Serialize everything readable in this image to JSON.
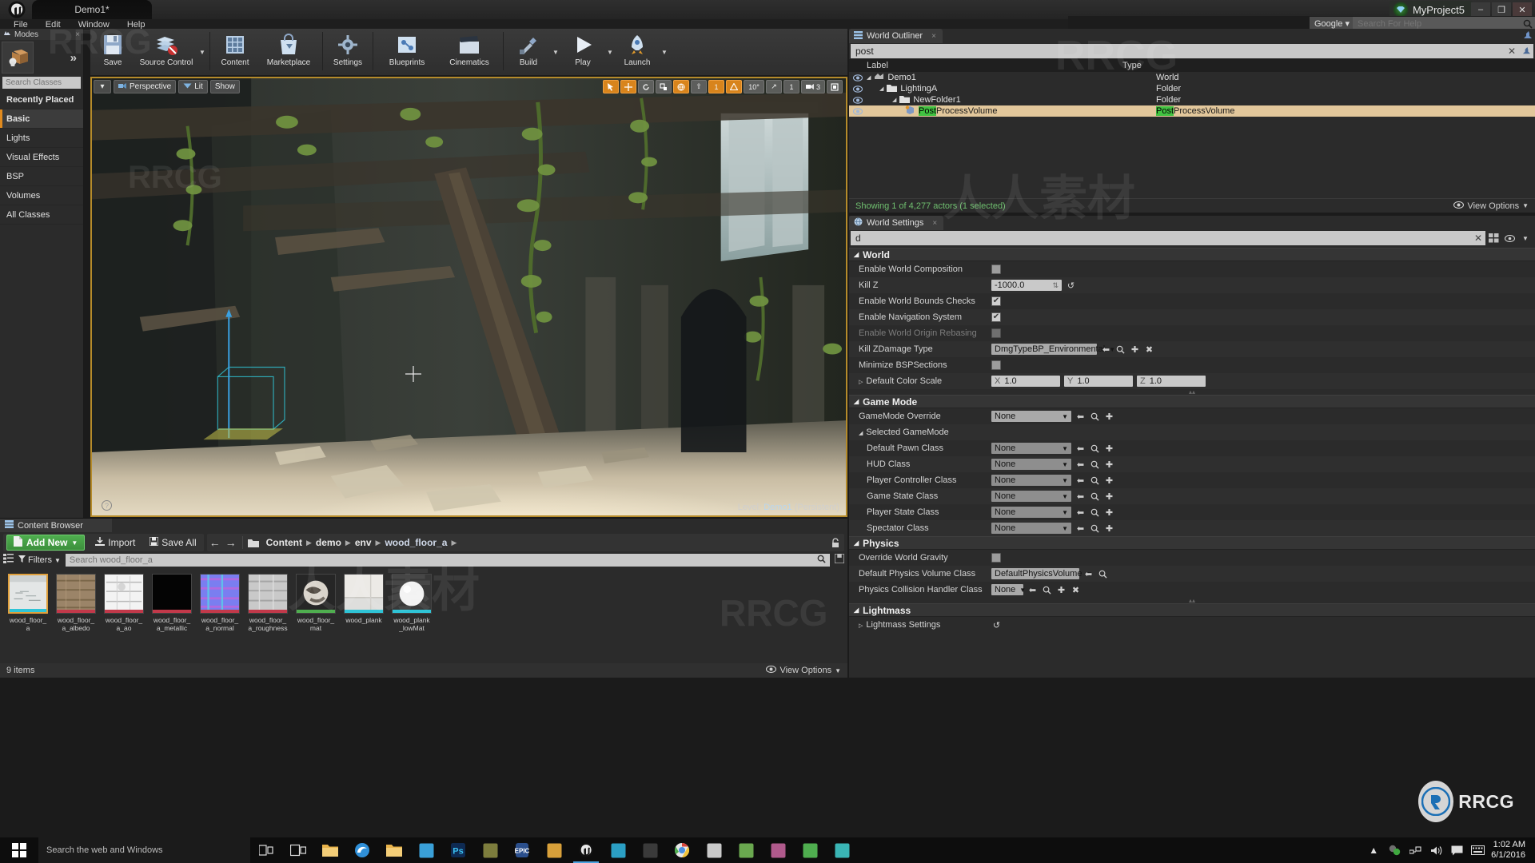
{
  "titlebar": {
    "tab_label": "Demo1*",
    "project_name": "MyProject5",
    "minimize": "–",
    "maximize": "❐",
    "close": "✕",
    "logo_icon": "unreal-engine-logo"
  },
  "menubar": {
    "items": [
      "File",
      "Edit",
      "Window",
      "Help"
    ],
    "search_engine": "Google",
    "help_placeholder": "Search For Help",
    "help_value": ""
  },
  "modes": {
    "title": "Modes",
    "close": "×",
    "expand": "»",
    "search_placeholder": "Search Classes",
    "search_value": "",
    "items": [
      {
        "label": "Recently Placed",
        "selected": false,
        "bold": true
      },
      {
        "label": "Basic",
        "selected": true,
        "bold": true
      },
      {
        "label": "Lights",
        "selected": false,
        "bold": false
      },
      {
        "label": "Visual Effects",
        "selected": false,
        "bold": false
      },
      {
        "label": "BSP",
        "selected": false,
        "bold": false
      },
      {
        "label": "Volumes",
        "selected": false,
        "bold": false
      },
      {
        "label": "All Classes",
        "selected": false,
        "bold": false
      }
    ]
  },
  "toolbar": {
    "buttons": [
      {
        "label": "Save",
        "icon": "save-icon",
        "caret": false
      },
      {
        "label": "Source Control",
        "icon": "source-control-icon",
        "caret": true
      },
      {
        "label": "Content",
        "icon": "content-icon",
        "caret": false
      },
      {
        "label": "Marketplace",
        "icon": "marketplace-icon",
        "caret": false
      },
      {
        "label": "Settings",
        "icon": "settings-gear-icon",
        "caret": false
      },
      {
        "label": "Blueprints",
        "icon": "blueprints-icon",
        "caret": false
      },
      {
        "label": "Cinematics",
        "icon": "cinematics-clapper-icon",
        "caret": false
      },
      {
        "label": "Build",
        "icon": "build-icon",
        "caret": true
      },
      {
        "label": "Play",
        "icon": "play-icon",
        "caret": true
      },
      {
        "label": "Launch",
        "icon": "launch-rocket-icon",
        "caret": true
      }
    ]
  },
  "viewport": {
    "perspective_label": "Perspective",
    "lit_label": "Lit",
    "show_label": "Show",
    "level_prefix": "Level:",
    "level_name": "Demo1",
    "level_suffix": "(Persistent)",
    "snap_angle": "10°",
    "grid_value": "1",
    "scale_value": "1",
    "camera_speed": "3",
    "help_icon": "question-mark-icon"
  },
  "content_browser": {
    "title": "Content Browser",
    "add_new": "Add New",
    "import": "Import",
    "save_all": "Save All",
    "breadcrumb": [
      "Content",
      "demo",
      "env",
      "wood_floor_a"
    ],
    "filters_label": "Filters",
    "search_placeholder": "Search wood_floor_a",
    "search_value": "",
    "status": "9 items",
    "view_options": "View Options",
    "assets": [
      {
        "name": "wood_floor_a",
        "bar": "#2fc4d6",
        "selected": true,
        "thumb": "material-sphere-light"
      },
      {
        "name": "wood_floor_a_albedo",
        "bar": "#c2394a",
        "selected": false,
        "thumb": "texture-albedo"
      },
      {
        "name": "wood_floor_a_ao",
        "bar": "#c2394a",
        "selected": false,
        "thumb": "texture-ao"
      },
      {
        "name": "wood_floor_a_metallic",
        "bar": "#c2394a",
        "selected": false,
        "thumb": "texture-metallic"
      },
      {
        "name": "wood_floor_a_normal",
        "bar": "#c2394a",
        "selected": false,
        "thumb": "texture-normal"
      },
      {
        "name": "wood_floor_a_roughness",
        "bar": "#c2394a",
        "selected": false,
        "thumb": "texture-roughness"
      },
      {
        "name": "wood_floor_mat",
        "bar": "#4fae4f",
        "selected": false,
        "thumb": "static-mesh"
      },
      {
        "name": "wood_plank",
        "bar": "#2fc4d6",
        "selected": false,
        "thumb": "material-plank"
      },
      {
        "name": "wood_plank_lowMat",
        "bar": "#2fc4d6",
        "selected": false,
        "thumb": "material-sphere-white"
      }
    ]
  },
  "outliner": {
    "tab_label": "World Outliner",
    "tab_close": "×",
    "search_value": "post",
    "clear_icon": "✕",
    "col_label": "Label",
    "col_type": "Type",
    "rows": [
      {
        "label": "Demo1",
        "type": "World",
        "indent": 0,
        "icon": "level-icon",
        "selected": false,
        "highlight": ""
      },
      {
        "label": "LightingA",
        "type": "Folder",
        "indent": 1,
        "icon": "folder-icon",
        "selected": false,
        "highlight": ""
      },
      {
        "label": "NewFolder1",
        "type": "Folder",
        "indent": 2,
        "icon": "folder-icon",
        "selected": false,
        "highlight": ""
      },
      {
        "label": "PostProcessVolume",
        "type": "PostProcessVolume",
        "indent": 3,
        "icon": "volume-icon",
        "selected": true,
        "highlight": "Post"
      }
    ],
    "status": "Showing 1 of 4,277 actors (1 selected)",
    "view_options": "View Options"
  },
  "world_settings": {
    "tab_label": "World Settings",
    "tab_close": "×",
    "search_value": "d",
    "clear_icon": "✕",
    "sections": [
      {
        "name": "World",
        "rows": [
          {
            "label": "Enable World Composition",
            "kind": "checkbox",
            "value": false,
            "indent": 0,
            "disabled": false
          },
          {
            "label": "Kill Z",
            "kind": "number",
            "value": "-1000.0",
            "indent": 0,
            "disabled": false,
            "reset": true
          },
          {
            "label": "Enable World Bounds Checks",
            "kind": "checkbox",
            "value": true,
            "indent": 0,
            "disabled": false
          },
          {
            "label": "Enable Navigation System",
            "kind": "checkbox",
            "value": true,
            "indent": 0,
            "disabled": false
          },
          {
            "label": "Enable World Origin Rebasing",
            "kind": "checkbox",
            "value": false,
            "indent": 0,
            "disabled": true
          },
          {
            "label": "Kill ZDamage Type",
            "kind": "assetcombo",
            "value": "DmgTypeBP_Environmental",
            "indent": 0,
            "disabled": false
          },
          {
            "label": "Minimize BSPSections",
            "kind": "checkbox",
            "value": false,
            "indent": 0,
            "disabled": false
          },
          {
            "label": "Default Color Scale",
            "kind": "vector",
            "value": {
              "x": "1.0",
              "y": "1.0",
              "z": "1.0"
            },
            "indent": 0,
            "disabled": false
          }
        ]
      },
      {
        "name": "Game Mode",
        "rows": [
          {
            "label": "GameMode Override",
            "kind": "combo",
            "value": "None",
            "indent": 0,
            "disabled": false
          },
          {
            "label": "Selected GameMode",
            "kind": "group",
            "value": "",
            "indent": 0,
            "disabled": false
          },
          {
            "label": "Default Pawn Class",
            "kind": "combo_ro",
            "value": "None",
            "indent": 1,
            "disabled": false
          },
          {
            "label": "HUD Class",
            "kind": "combo_ro",
            "value": "None",
            "indent": 1,
            "disabled": false
          },
          {
            "label": "Player Controller Class",
            "kind": "combo_ro",
            "value": "None",
            "indent": 1,
            "disabled": false
          },
          {
            "label": "Game State Class",
            "kind": "combo_ro",
            "value": "None",
            "indent": 1,
            "disabled": false
          },
          {
            "label": "Player State Class",
            "kind": "combo_ro",
            "value": "None",
            "indent": 1,
            "disabled": false
          },
          {
            "label": "Spectator Class",
            "kind": "combo_ro",
            "value": "None",
            "indent": 1,
            "disabled": false
          }
        ]
      },
      {
        "name": "Physics",
        "rows": [
          {
            "label": "Override World Gravity",
            "kind": "checkbox",
            "value": false,
            "indent": 0,
            "disabled": false
          },
          {
            "label": "Default Physics Volume Class",
            "kind": "combo_sm",
            "value": "DefaultPhysicsVolume",
            "indent": 0,
            "disabled": false
          },
          {
            "label": "Physics Collision Handler Class",
            "kind": "combo_xs",
            "value": "None",
            "indent": 0,
            "disabled": false
          }
        ]
      },
      {
        "name": "Lightmass",
        "rows": [
          {
            "label": "Lightmass Settings",
            "kind": "sub",
            "value": "",
            "indent": 0,
            "disabled": false
          }
        ]
      }
    ]
  },
  "taskbar": {
    "search_placeholder": "Search the web and Windows",
    "apps": [
      "task-view-icon",
      "file-explorer-icon",
      "edge-icon",
      "folder-icon",
      "store-icon",
      "photoshop-icon",
      "app-olive-icon",
      "epic-games-icon",
      "picture-icon",
      "unreal-editor-icon",
      "unreal-project-icon",
      "dark-app-icon",
      "chrome-icon",
      "app-misc-icon",
      "android-icon",
      "palette-icon",
      "green-app-icon",
      "teal-app-icon"
    ],
    "tray": [
      "show-hidden-icon",
      "sync-icon",
      "network-icon",
      "volume-icon",
      "notification-icon",
      "keyboard-icon"
    ],
    "time": "1:02 AM",
    "date": "6/1/2016"
  },
  "watermarks": {
    "a": "RRCG",
    "b": "RRCG",
    "c": "人人素材",
    "d": "人人素材",
    "e": "RRCG",
    "f": "RRCG",
    "logo_text": "RRCG"
  }
}
